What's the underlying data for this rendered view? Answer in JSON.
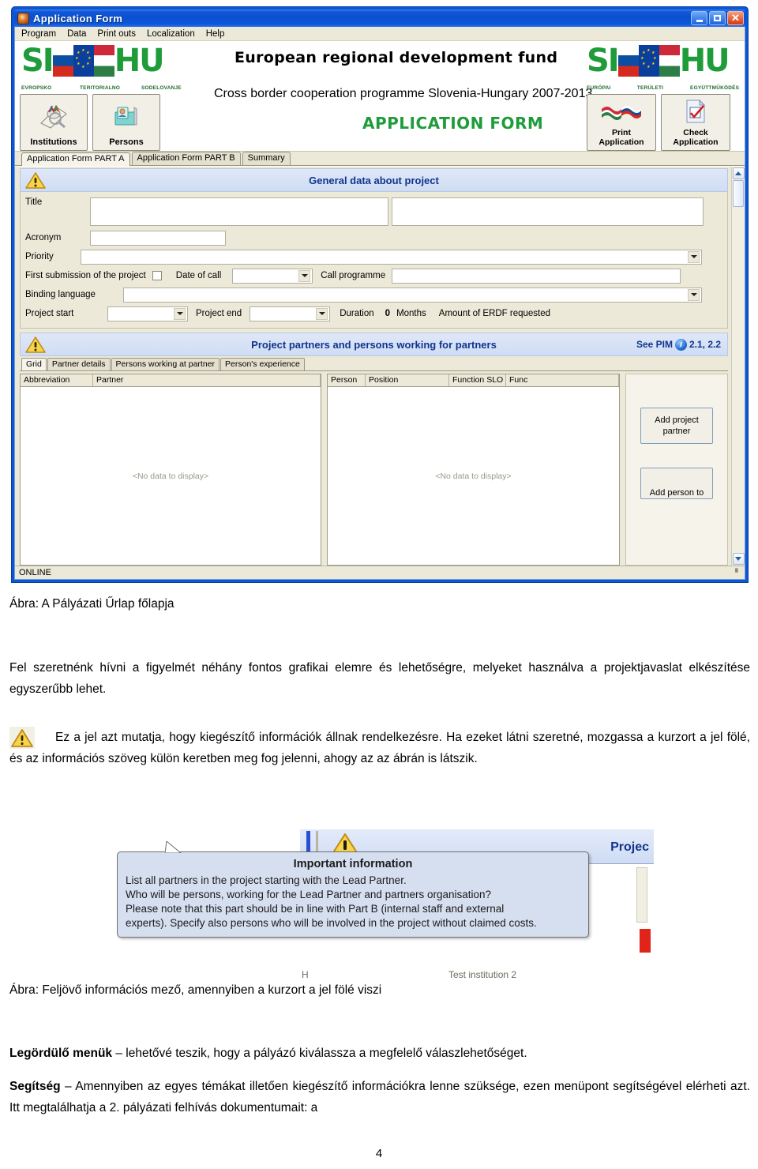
{
  "window": {
    "title": "Application Form",
    "icon": "app-icon",
    "buttons": {
      "minimize": "minimize",
      "maximize": "maximize",
      "close": "close"
    },
    "menu": [
      "Program",
      "Data",
      "Print outs",
      "Localization",
      "Help"
    ],
    "status": "ONLINE"
  },
  "banner": {
    "logo_left": {
      "si": "SI",
      "hu": "HU",
      "captions": [
        "EVROPSKO",
        "TERITORIALNO",
        "SODELOVANJE"
      ]
    },
    "logo_right": {
      "si": "SI",
      "hu": "HU",
      "captions": [
        "EURÓPAI",
        "TERÜLETI",
        "EGYÜTTMŰKÖDÉS"
      ]
    },
    "title": "European  regional development fund",
    "subtitle": "Cross border cooperation programme Slovenia-Hungary 2007-2013",
    "form_label": "APPLICATION FORM",
    "left_buttons": [
      {
        "label": "Institutions",
        "icon": "institutions-icon"
      },
      {
        "label": "Persons",
        "icon": "persons-icon"
      }
    ],
    "right_buttons": [
      {
        "line1": "Print",
        "line2": "Application",
        "icon": "flags-icon"
      },
      {
        "line1": "Check",
        "line2": "Application",
        "icon": "checked-document-icon"
      }
    ]
  },
  "tabs": [
    {
      "label": "Application Form PART A",
      "active": true
    },
    {
      "label": "Application Form PART B",
      "active": false
    },
    {
      "label": "Summary",
      "active": false
    }
  ],
  "general_section": {
    "heading": "General data about project",
    "warning_icon": "warning-triangle-icon",
    "fields": {
      "title_label": "Title",
      "title_value": "",
      "title_value2": "",
      "acronym_label": "Acronym",
      "acronym_value": "",
      "priority_label": "Priority",
      "priority_value": "",
      "first_submission_label": "First submission of the project",
      "first_submission_checked": false,
      "date_of_call_label": "Date of call",
      "date_of_call_value": "",
      "call_programme_label": "Call programme",
      "call_programme_value": "",
      "binding_language_label": "Binding language",
      "binding_language_value": "",
      "project_start_label": "Project start",
      "project_start_value": "",
      "project_end_label": "Project end",
      "project_end_value": "",
      "duration_label": "Duration",
      "duration_value": "0",
      "months_label": "Months",
      "erdf_label": "Amount of ERDF requested"
    }
  },
  "partners_section": {
    "heading": "Project partners and persons working for partners",
    "see_pim": "See PIM",
    "pim_ref": "2.1, 2.2",
    "info_icon": "info-circle-icon",
    "warning_icon": "warning-triangle-icon",
    "subtabs": [
      {
        "label": "Grid",
        "active": true
      },
      {
        "label": "Partner details",
        "active": false
      },
      {
        "label": "Persons working at partner",
        "active": false
      },
      {
        "label": "Person's experience",
        "active": false
      }
    ],
    "left_grid": {
      "columns": [
        "Abbreviation",
        "Partner"
      ],
      "empty_text": "<No data to display>"
    },
    "right_grid": {
      "columns": [
        "Person",
        "Position",
        "Function SLO",
        "Func"
      ],
      "empty_text": "<No data to display>"
    },
    "buttons": [
      {
        "line1": "Add project",
        "line2": "partner"
      },
      {
        "line1": "Add person to",
        "line2": ""
      }
    ]
  },
  "document": {
    "caption1": "Ábra: A Pályázati Űrlap főlapja",
    "para1": "Fel szeretnénk hívni a figyelmét néhány fontos grafikai elemre és lehetőségre, melyeket használva a projektjavaslat elkészítése egyszerűbb lehet.",
    "para2": "Ez a jel azt mutatja, hogy kiegészítő információk állnak rendelkezésre. Ha ezeket látni szeretné, mozgassa a kurzort a jel fölé, és az információs szöveg külön keretben meg fog jelenni, ahogy az az ábrán is látszik.",
    "caption2": "Ábra: Feljövő információs mező, amennyiben a kurzort a jel fölé viszi",
    "bold1": "Legördülő menük",
    "para3": " – lehetővé teszik, hogy a pályázó kiválassza a megfelelő válaszlehetőséget.",
    "bold2": "Segítség",
    "para4": " – Amennyiben az egyes témákat illetően kiegészítő információkra lenne szüksége, ezen menüpont segítségével elérheti azt. Itt megtalálhatja a 2. pályázati felhívás dokumentumait: a",
    "page_number": "4"
  },
  "tooltip_shot": {
    "title": "Important information",
    "lines": [
      "List all partners in the project starting with the Lead Partner.",
      "Who will be  persons, working for the Lead Partner and partners organisation?",
      "Please note that this part should be in line with Part B (internal staff and external",
      "experts). Specify also persons who will be involved in the project without claimed costs."
    ],
    "bg_heading": "Projec",
    "bg_row_left": "H",
    "bg_row_right": "Test institution 2"
  },
  "colors": {
    "title_bar_blue": "#0a4fd0",
    "section_heading_blue": "#12348e",
    "logo_green": "#1f9c3a",
    "form_bg": "#ece9d8",
    "tooltip_bg": "#d6dff0"
  }
}
